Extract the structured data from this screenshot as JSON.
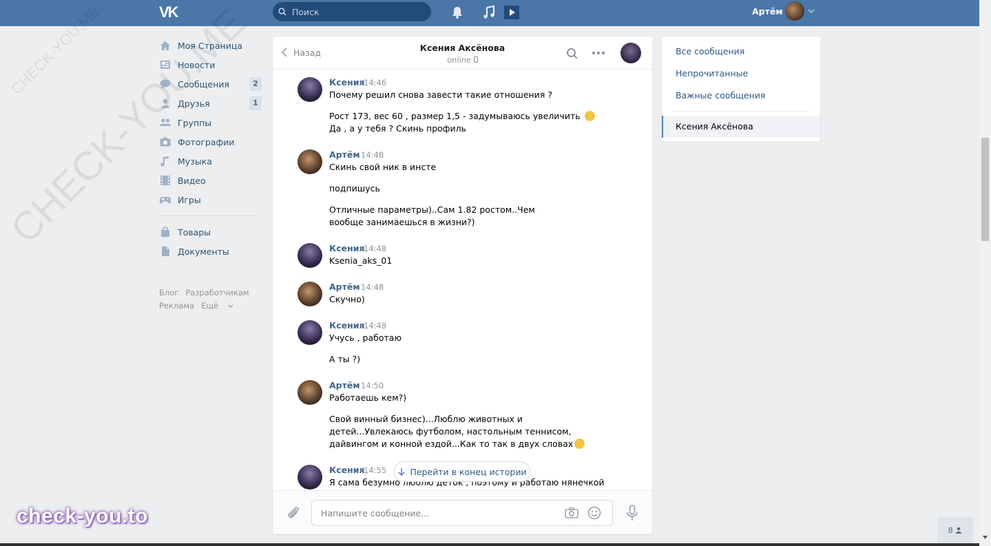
{
  "header": {
    "logo": "VK",
    "search_placeholder": "Поиск",
    "user_name": "Артём"
  },
  "nav": {
    "items": [
      {
        "label": "Моя Страница",
        "icon": "home-icon"
      },
      {
        "label": "Новости",
        "icon": "news-icon"
      },
      {
        "label": "Сообщения",
        "icon": "messages-icon",
        "badge": "2"
      },
      {
        "label": "Друзья",
        "icon": "friends-icon",
        "badge": "1"
      },
      {
        "label": "Группы",
        "icon": "groups-icon"
      },
      {
        "label": "Фотографии",
        "icon": "camera-icon"
      },
      {
        "label": "Музыка",
        "icon": "music-icon"
      },
      {
        "label": "Видео",
        "icon": "video-icon"
      },
      {
        "label": "Игры",
        "icon": "gamepad-icon"
      }
    ],
    "items2": [
      {
        "label": "Товары",
        "icon": "bag-icon"
      },
      {
        "label": "Документы",
        "icon": "document-icon"
      }
    ],
    "footer": [
      "Блог",
      "Разработчикам",
      "Реклама",
      "Ещё"
    ]
  },
  "chat": {
    "back_label": "Назад",
    "peer_name": "Ксения Аксёнова",
    "peer_status": "online",
    "messages": [
      {
        "author": "Ксения",
        "time": "14:46",
        "paragraphs": [
          "Почему решил снова завести такие отношения ?",
          "Рост 173, вес 60 , размер 1,5 - задумываюсь увеличить",
          "Да , а у тебя ? Скинь профиль"
        ]
      },
      {
        "author": "Артём",
        "time": "14:48",
        "paragraphs": [
          "Скинь свой ник в инсте",
          "подпишусь",
          "Отличные параметры)..Сам 1.82 ростом..Чем вообще занимаешься в жизни?)"
        ]
      },
      {
        "author": "Ксения",
        "time": "14:48",
        "paragraphs": [
          "Ksenia_aks_01"
        ]
      },
      {
        "author": "Артём",
        "time": "14:48",
        "paragraphs": [
          "Скучно)"
        ]
      },
      {
        "author": "Ксения",
        "time": "14:48",
        "paragraphs": [
          "Учусь , работаю",
          "А ты ?)"
        ]
      },
      {
        "author": "Артём",
        "time": "14:50",
        "paragraphs": [
          "Работаешь кем?)",
          "Свой винный бизнес)...Люблю животных и детей...Увлекаюсь футболом, настольным теннисом, дайвингом и конной ездой...Как то так в двух словах"
        ]
      },
      {
        "author": "Ксения",
        "time": "14:55",
        "paragraphs": [
          "Я сама безумно люблю деток , поэтому и работаю нянечкой"
        ]
      }
    ],
    "scroll_to_end": "Перейти в конец истории",
    "input_placeholder": "Напишите сообщение..."
  },
  "filters": {
    "all": "Все сообщения",
    "unread": "Непрочитанные",
    "important": "Важные сообщения",
    "active": "Ксения Аксёнова"
  },
  "watermark": {
    "diagonal": "CHECK-YOU.ME",
    "brand": "check-you.to"
  },
  "online_count": "8",
  "colors": {
    "header_bg": "#4a76a8",
    "link": "#2a5885",
    "page_bg": "#edeef0"
  }
}
